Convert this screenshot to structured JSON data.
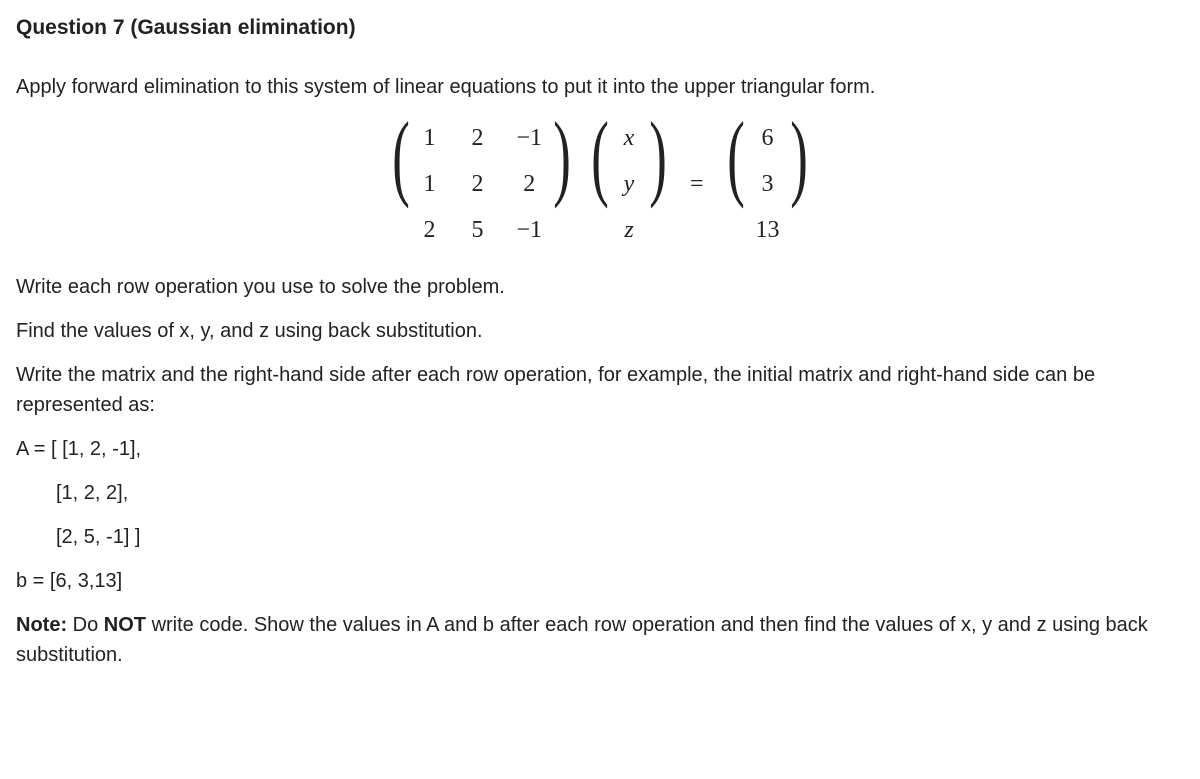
{
  "title": "Question 7 (Gaussian elimination)",
  "p_apply": "Apply forward elimination to this system of linear equations to put it into the upper triangular form.",
  "equation": {
    "A": [
      [
        "1",
        "2",
        "−1"
      ],
      [
        "1",
        "2",
        "2"
      ],
      [
        "2",
        "5",
        "−1"
      ]
    ],
    "xvec": [
      "x",
      "y",
      "z"
    ],
    "eq": "=",
    "b": [
      "6",
      "3",
      "13"
    ]
  },
  "p_rowops": "Write each row operation you use to solve the problem.",
  "p_backsub": "Find the values of x, y, and z using back substitution.",
  "p_repr": "Write the matrix and the right-hand side after each row operation, for example, the initial matrix and right-hand side can be represented as:",
  "code": {
    "l1": "A = [ [1, 2, -1],",
    "l2": "[1, 2, 2],",
    "l3": "[2, 5, -1] ]",
    "l4": "b = [6, 3,13]"
  },
  "note": {
    "label": "Note:",
    "pre": " Do ",
    "not": "NOT",
    "post": " write code. Show the values in A and b after each row operation and then find the values of x, y and z using back substitution."
  }
}
